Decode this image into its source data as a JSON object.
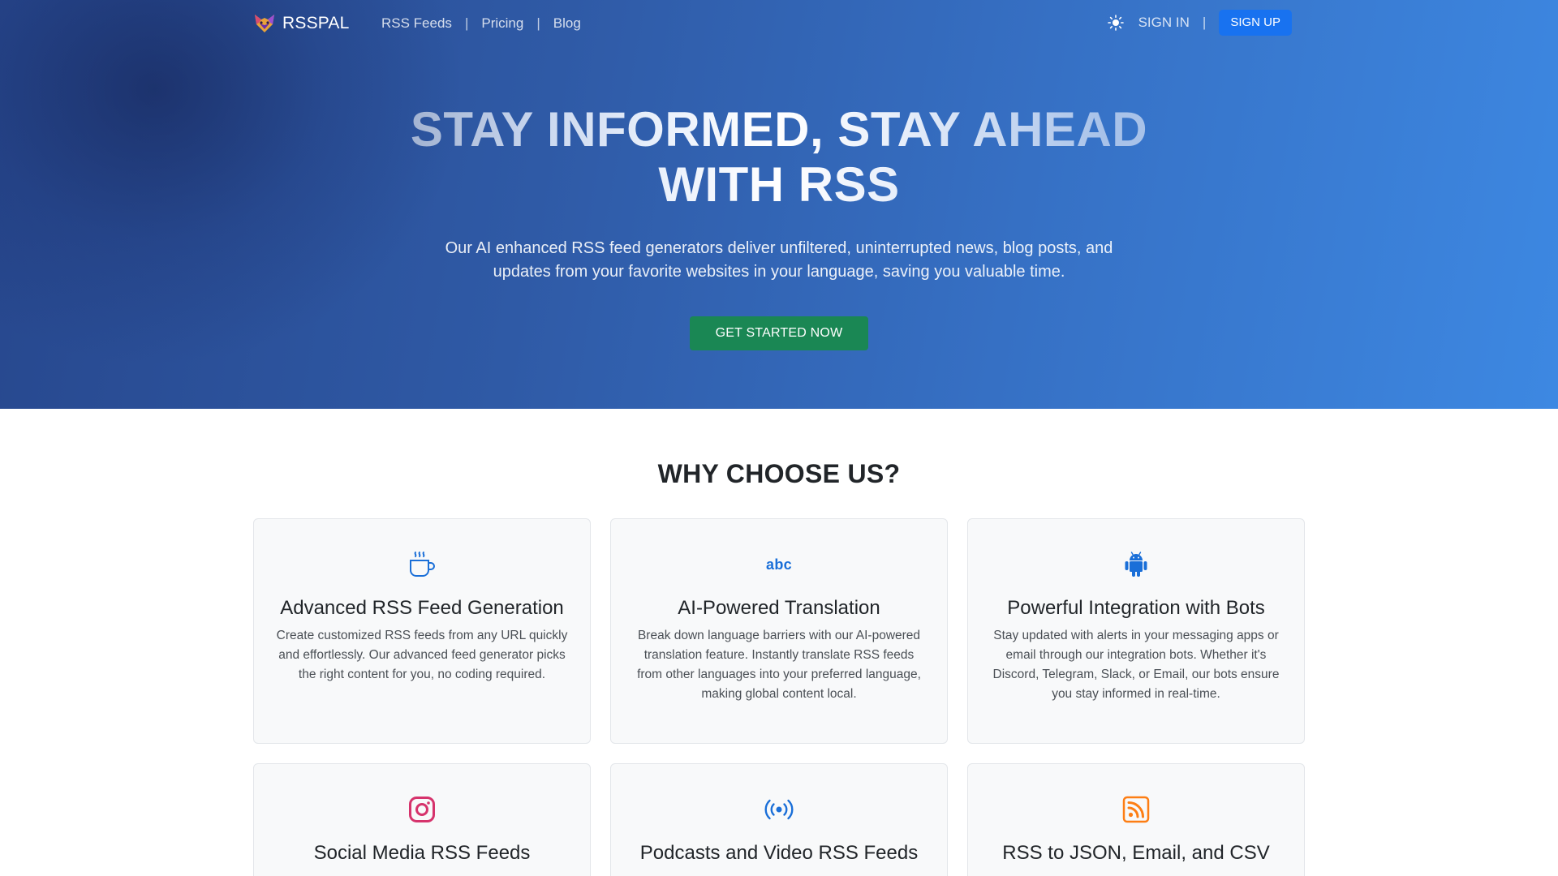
{
  "nav": {
    "brand": "RSSPAL",
    "links": [
      "RSS Feeds",
      "Pricing",
      "Blog"
    ],
    "separator": "|",
    "sign_in": "SIGN IN",
    "sign_up": "SIGN UP"
  },
  "hero": {
    "title_line1": "STAY INFORMED, STAY AHEAD",
    "title_line2": "WITH RSS",
    "subtitle": "Our AI enhanced RSS feed generators deliver unfiltered, uninterrupted news, blog posts, and updates from your favorite websites in your language, saving you valuable time.",
    "cta": "GET STARTED NOW"
  },
  "features": {
    "title": "WHY CHOOSE US?",
    "cards": [
      {
        "icon": "coffee-cup-icon",
        "title": "Advanced RSS Feed Generation",
        "text": "Create customized RSS feeds from any URL quickly and effortlessly. Our advanced feed generator picks the right content for you, no coding required."
      },
      {
        "icon": "abc-icon",
        "icon_text": "abc",
        "title": "AI-Powered Translation",
        "text": "Break down language barriers with our AI-powered translation feature. Instantly translate RSS feeds from other languages into your preferred language, making global content local."
      },
      {
        "icon": "android-icon",
        "title": "Powerful Integration with Bots",
        "text": "Stay updated with alerts in your messaging apps or email through our integration bots. Whether it's Discord, Telegram, Slack, or Email, our bots ensure you stay informed in real-time."
      },
      {
        "icon": "instagram-icon",
        "title": "Social Media RSS Feeds",
        "text": ""
      },
      {
        "icon": "broadcast-icon",
        "title": "Podcasts and Video RSS Feeds",
        "text": ""
      },
      {
        "icon": "rss-icon",
        "title": "RSS to JSON, Email, and CSV",
        "text": ""
      }
    ]
  },
  "colors": {
    "hero_gradient_start": "#27478d",
    "hero_gradient_end": "#3d88e2",
    "signup_button": "#1872f0",
    "cta_button": "#1a8754",
    "icon_blue": "#1a6fd8",
    "instagram": "#d6336c",
    "rss_orange": "#fd7e14"
  }
}
